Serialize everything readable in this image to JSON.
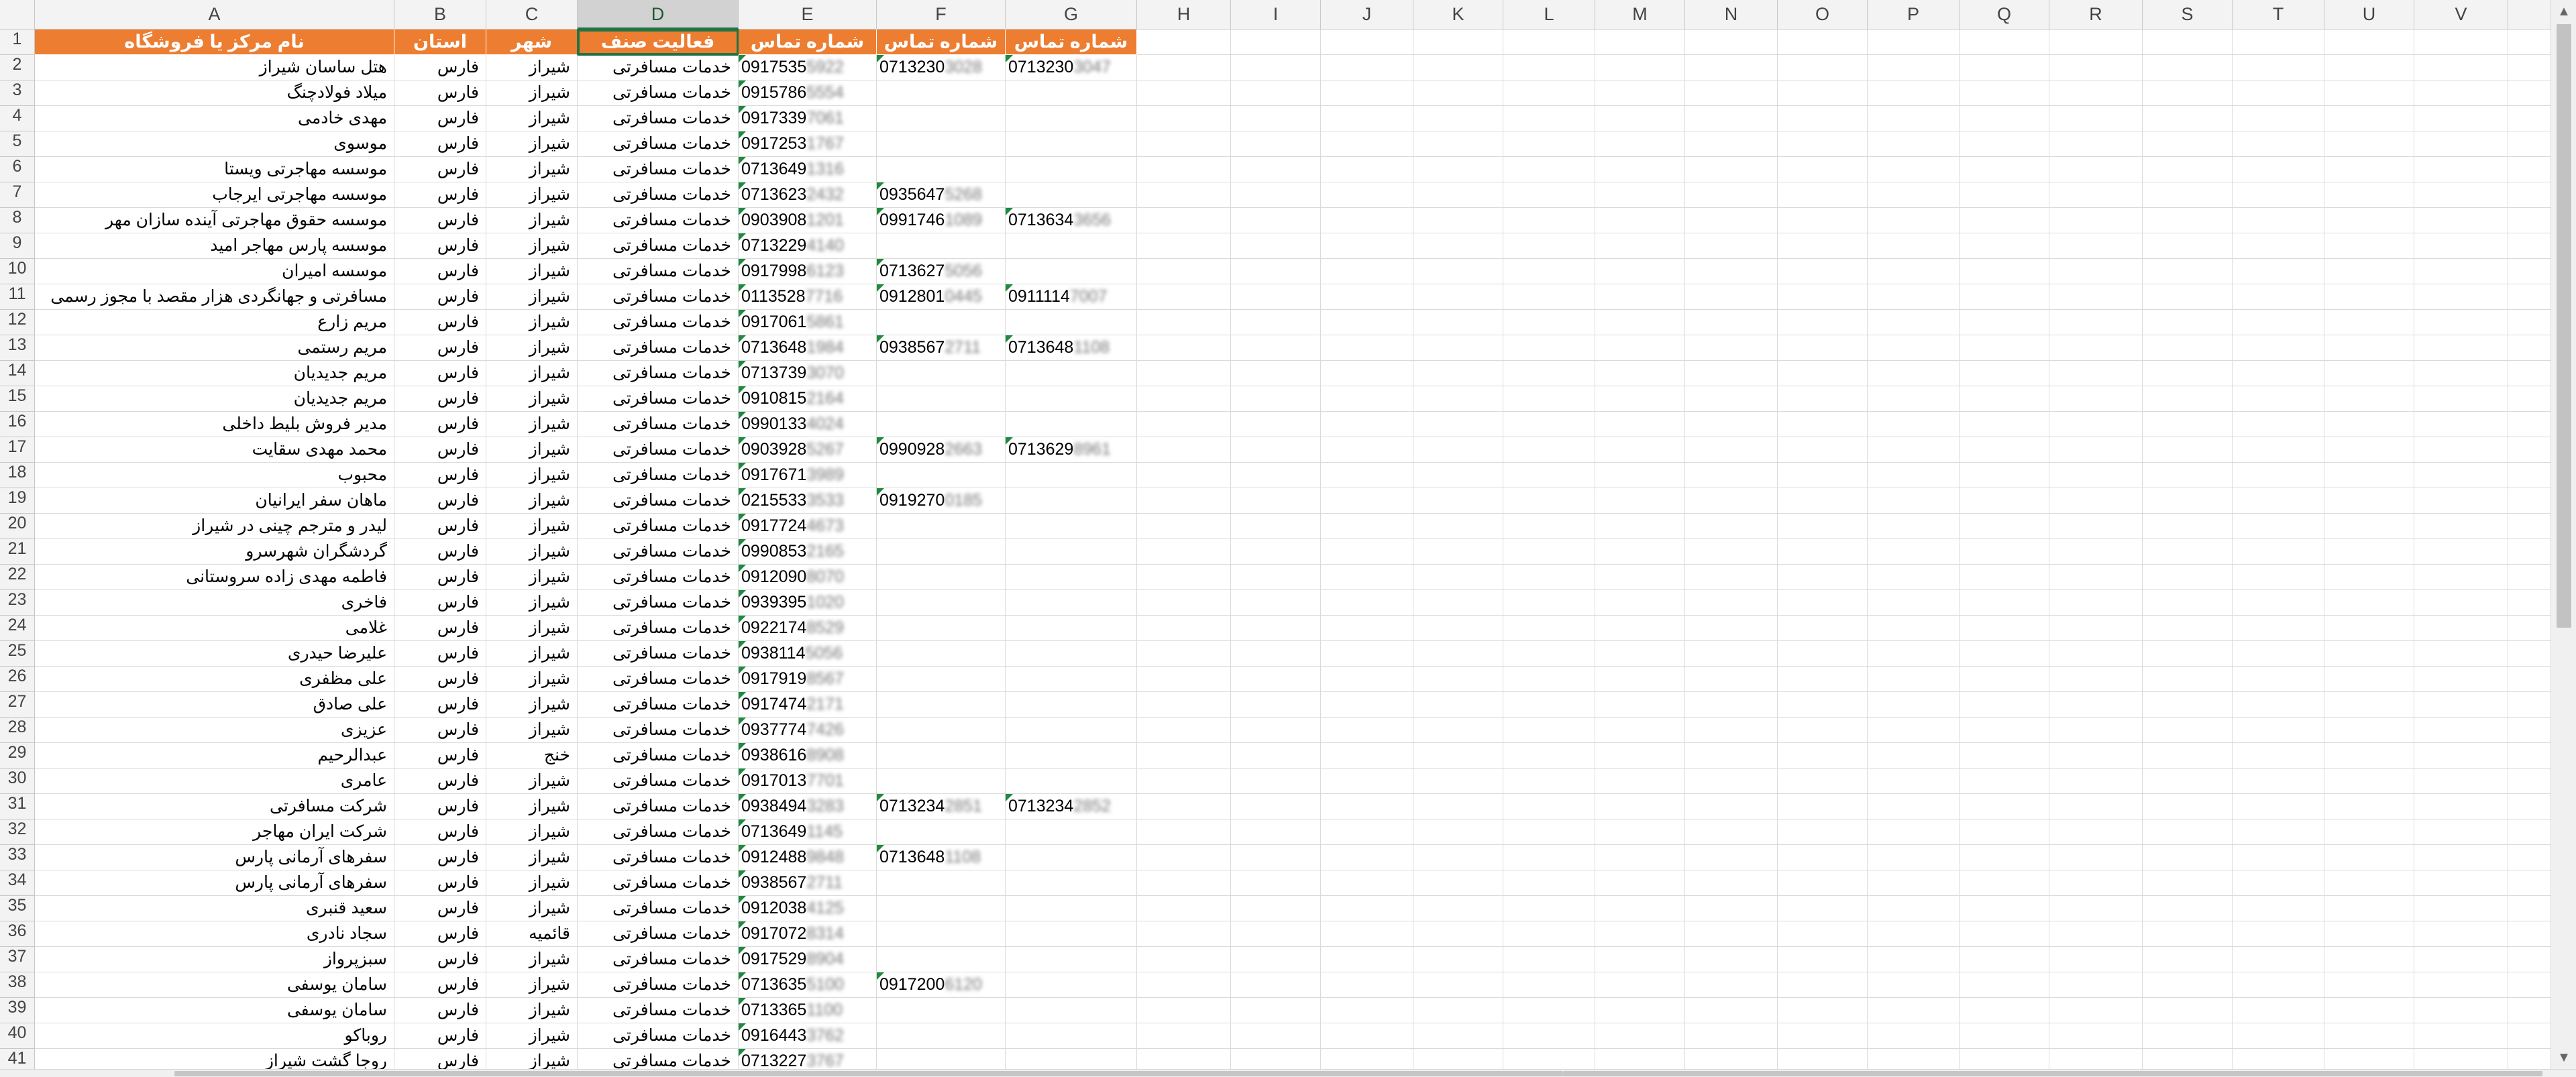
{
  "columns": [
    "A",
    "B",
    "C",
    "D",
    "E",
    "F",
    "G",
    "H",
    "I",
    "J",
    "K",
    "L",
    "M",
    "N",
    "O",
    "P",
    "Q",
    "R",
    "S",
    "T",
    "U",
    "V"
  ],
  "selected_column": "D",
  "header": {
    "row_number": "1",
    "name": "نام مرکز یا فروشگاه",
    "province": "استان",
    "city": "شهر",
    "activity": "فعالیت صنف",
    "phone1": "شماره تماس",
    "phone2": "شماره تماس",
    "phone3": "شماره تماس"
  },
  "rows": [
    {
      "row": "2",
      "name": "هتل ساسان شیراز",
      "province": "فارس",
      "city": "شیراز",
      "activity": "خدمات مسافرتی",
      "p1": "0917535",
      "p1b": "5922",
      "p2": "0713230",
      "p2b": "3028",
      "p3": "0713230",
      "p3b": "3047"
    },
    {
      "row": "3",
      "name": "میلاد فولادچنگ",
      "province": "فارس",
      "city": "شیراز",
      "activity": "خدمات مسافرتی",
      "p1": "0915786",
      "p1b": "5554",
      "p2": "",
      "p2b": "",
      "p3": "",
      "p3b": ""
    },
    {
      "row": "4",
      "name": "مهدی خادمی",
      "province": "فارس",
      "city": "شیراز",
      "activity": "خدمات مسافرتی",
      "p1": "0917339",
      "p1b": "7061",
      "p2": "",
      "p2b": "",
      "p3": "",
      "p3b": ""
    },
    {
      "row": "5",
      "name": "موسوی",
      "province": "فارس",
      "city": "شیراز",
      "activity": "خدمات مسافرتی",
      "p1": "0917253",
      "p1b": "1767",
      "p2": "",
      "p2b": "",
      "p3": "",
      "p3b": ""
    },
    {
      "row": "6",
      "name": "موسسه مهاجرتی ویستا",
      "province": "فارس",
      "city": "شیراز",
      "activity": "خدمات مسافرتی",
      "p1": "0713649",
      "p1b": "1316",
      "p2": "",
      "p2b": "",
      "p3": "",
      "p3b": ""
    },
    {
      "row": "7",
      "name": "موسسه مهاجرتی ایرجاب",
      "province": "فارس",
      "city": "شیراز",
      "activity": "خدمات مسافرتی",
      "p1": "0713623",
      "p1b": "2432",
      "p2": "0935647",
      "p2b": "5268",
      "p3": "",
      "p3b": ""
    },
    {
      "row": "8",
      "name": "موسسه حقوق مهاجرتی آینده سازان مهر",
      "province": "فارس",
      "city": "شیراز",
      "activity": "خدمات مسافرتی",
      "p1": "0903908",
      "p1b": "1201",
      "p2": "0991746",
      "p2b": "1089",
      "p3": "0713634",
      "p3b": "3656"
    },
    {
      "row": "9",
      "name": "موسسه پارس مهاجر امید",
      "province": "فارس",
      "city": "شیراز",
      "activity": "خدمات مسافرتی",
      "p1": "0713229",
      "p1b": "4140",
      "p2": "",
      "p2b": "",
      "p3": "",
      "p3b": ""
    },
    {
      "row": "10",
      "name": "موسسه امیران",
      "province": "فارس",
      "city": "شیراز",
      "activity": "خدمات مسافرتی",
      "p1": "0917998",
      "p1b": "6123",
      "p2": "0713627",
      "p2b": "5056",
      "p3": "",
      "p3b": ""
    },
    {
      "row": "11",
      "name": "مسافرتی و جهانگردی هزار مقصد با مجوز رسمی",
      "province": "فارس",
      "city": "شیراز",
      "activity": "خدمات مسافرتی",
      "p1": "0113528",
      "p1b": "7716",
      "p2": "0912801",
      "p2b": "0445",
      "p3": "0911114",
      "p3b": "7007"
    },
    {
      "row": "12",
      "name": "مریم زارع",
      "province": "فارس",
      "city": "شیراز",
      "activity": "خدمات مسافرتی",
      "p1": "0917061",
      "p1b": "5861",
      "p2": "",
      "p2b": "",
      "p3": "",
      "p3b": ""
    },
    {
      "row": "13",
      "name": "مریم رستمی",
      "province": "فارس",
      "city": "شیراز",
      "activity": "خدمات مسافرتی",
      "p1": "0713648",
      "p1b": "1984",
      "p2": "0938567",
      "p2b": "2711",
      "p3": "0713648",
      "p3b": "1108"
    },
    {
      "row": "14",
      "name": "مریم جدیدیان",
      "province": "فارس",
      "city": "شیراز",
      "activity": "خدمات مسافرتی",
      "p1": "0713739",
      "p1b": "3070",
      "p2": "",
      "p2b": "",
      "p3": "",
      "p3b": ""
    },
    {
      "row": "15",
      "name": "مریم جدیدیان",
      "province": "فارس",
      "city": "شیراز",
      "activity": "خدمات مسافرتی",
      "p1": "0910815",
      "p1b": "2164",
      "p2": "",
      "p2b": "",
      "p3": "",
      "p3b": ""
    },
    {
      "row": "16",
      "name": "مدیر فروش بلیط داخلی",
      "province": "فارس",
      "city": "شیراز",
      "activity": "خدمات مسافرتی",
      "p1": "0990133",
      "p1b": "4024",
      "p2": "",
      "p2b": "",
      "p3": "",
      "p3b": ""
    },
    {
      "row": "17",
      "name": "محمد مهدی سقایت",
      "province": "فارس",
      "city": "شیراز",
      "activity": "خدمات مسافرتی",
      "p1": "0903928",
      "p1b": "5267",
      "p2": "0990928",
      "p2b": "2663",
      "p3": "0713629",
      "p3b": "8961"
    },
    {
      "row": "18",
      "name": "محبوب",
      "province": "فارس",
      "city": "شیراز",
      "activity": "خدمات مسافرتی",
      "p1": "0917671",
      "p1b": "3989",
      "p2": "",
      "p2b": "",
      "p3": "",
      "p3b": ""
    },
    {
      "row": "19",
      "name": "ماهان سفر ایرانیان",
      "province": "فارس",
      "city": "شیراز",
      "activity": "خدمات مسافرتی",
      "p1": "0215533",
      "p1b": "3533",
      "p2": "0919270",
      "p2b": "0185",
      "p3": "",
      "p3b": ""
    },
    {
      "row": "20",
      "name": "لیدر و مترجم چینی در شیراز",
      "province": "فارس",
      "city": "شیراز",
      "activity": "خدمات مسافرتی",
      "p1": "0917724",
      "p1b": "4673",
      "p2": "",
      "p2b": "",
      "p3": "",
      "p3b": ""
    },
    {
      "row": "21",
      "name": "گردشگران شهرسرو",
      "province": "فارس",
      "city": "شیراز",
      "activity": "خدمات مسافرتی",
      "p1": "0990853",
      "p1b": "2165",
      "p2": "",
      "p2b": "",
      "p3": "",
      "p3b": ""
    },
    {
      "row": "22",
      "name": "فاطمه مهدی زاده سروستانی",
      "province": "فارس",
      "city": "شیراز",
      "activity": "خدمات مسافرتی",
      "p1": "0912090",
      "p1b": "8070",
      "p2": "",
      "p2b": "",
      "p3": "",
      "p3b": ""
    },
    {
      "row": "23",
      "name": "فاخری",
      "province": "فارس",
      "city": "شیراز",
      "activity": "خدمات مسافرتی",
      "p1": "0939395",
      "p1b": "1020",
      "p2": "",
      "p2b": "",
      "p3": "",
      "p3b": ""
    },
    {
      "row": "24",
      "name": "غلامی",
      "province": "فارس",
      "city": "شیراز",
      "activity": "خدمات مسافرتی",
      "p1": "0922174",
      "p1b": "8529",
      "p2": "",
      "p2b": "",
      "p3": "",
      "p3b": ""
    },
    {
      "row": "25",
      "name": "علیرضا حیدری",
      "province": "فارس",
      "city": "شیراز",
      "activity": "خدمات مسافرتی",
      "p1": "0938114",
      "p1b": "5056",
      "p2": "",
      "p2b": "",
      "p3": "",
      "p3b": ""
    },
    {
      "row": "26",
      "name": "علی مظفری",
      "province": "فارس",
      "city": "شیراز",
      "activity": "خدمات مسافرتی",
      "p1": "0917919",
      "p1b": "8567",
      "p2": "",
      "p2b": "",
      "p3": "",
      "p3b": ""
    },
    {
      "row": "27",
      "name": "علی صادق",
      "province": "فارس",
      "city": "شیراز",
      "activity": "خدمات مسافرتی",
      "p1": "0917474",
      "p1b": "2171",
      "p2": "",
      "p2b": "",
      "p3": "",
      "p3b": ""
    },
    {
      "row": "28",
      "name": "عزیزی",
      "province": "فارس",
      "city": "شیراز",
      "activity": "خدمات مسافرتی",
      "p1": "0937774",
      "p1b": "7426",
      "p2": "",
      "p2b": "",
      "p3": "",
      "p3b": ""
    },
    {
      "row": "29",
      "name": "عبدالرحیم",
      "province": "فارس",
      "city": "خنج",
      "activity": "خدمات مسافرتی",
      "p1": "0938616",
      "p1b": "8908",
      "p2": "",
      "p2b": "",
      "p3": "",
      "p3b": ""
    },
    {
      "row": "30",
      "name": "عامری",
      "province": "فارس",
      "city": "شیراز",
      "activity": "خدمات مسافرتی",
      "p1": "0917013",
      "p1b": "7701",
      "p2": "",
      "p2b": "",
      "p3": "",
      "p3b": ""
    },
    {
      "row": "31",
      "name": "شرکت مسافرتی",
      "province": "فارس",
      "city": "شیراز",
      "activity": "خدمات مسافرتی",
      "p1": "0938494",
      "p1b": "3283",
      "p2": "0713234",
      "p2b": "2851",
      "p3": "0713234",
      "p3b": "2852"
    },
    {
      "row": "32",
      "name": "شرکت ایران مهاجر",
      "province": "فارس",
      "city": "شیراز",
      "activity": "خدمات مسافرتی",
      "p1": "0713649",
      "p1b": "1145",
      "p2": "",
      "p2b": "",
      "p3": "",
      "p3b": ""
    },
    {
      "row": "33",
      "name": "سفرهای آرمانی پارس",
      "province": "فارس",
      "city": "شیراز",
      "activity": "خدمات مسافرتی",
      "p1": "0912488",
      "p1b": "9848",
      "p2": "0713648",
      "p2b": "1108",
      "p3": "",
      "p3b": ""
    },
    {
      "row": "34",
      "name": "سفرهای آرمانی پارس",
      "province": "فارس",
      "city": "شیراز",
      "activity": "خدمات مسافرتی",
      "p1": "0938567",
      "p1b": "2711",
      "p2": "",
      "p2b": "",
      "p3": "",
      "p3b": ""
    },
    {
      "row": "35",
      "name": "سعید قنبری",
      "province": "فارس",
      "city": "شیراز",
      "activity": "خدمات مسافرتی",
      "p1": "0912038",
      "p1b": "4125",
      "p2": "",
      "p2b": "",
      "p3": "",
      "p3b": ""
    },
    {
      "row": "36",
      "name": "سجاد نادری",
      "province": "فارس",
      "city": "قائمیه",
      "activity": "خدمات مسافرتی",
      "p1": "0917072",
      "p1b": "8314",
      "p2": "",
      "p2b": "",
      "p3": "",
      "p3b": ""
    },
    {
      "row": "37",
      "name": "سبزپرواز",
      "province": "فارس",
      "city": "شیراز",
      "activity": "خدمات مسافرتی",
      "p1": "0917529",
      "p1b": "8904",
      "p2": "",
      "p2b": "",
      "p3": "",
      "p3b": ""
    },
    {
      "row": "38",
      "name": "سامان یوسفی",
      "province": "فارس",
      "city": "شیراز",
      "activity": "خدمات مسافرتی",
      "p1": "0713635",
      "p1b": "5100",
      "p2": "0917200",
      "p2b": "6120",
      "p3": "",
      "p3b": ""
    },
    {
      "row": "39",
      "name": "سامان یوسفی",
      "province": "فارس",
      "city": "شیراز",
      "activity": "خدمات مسافرتی",
      "p1": "0713365",
      "p1b": "1100",
      "p2": "",
      "p2b": "",
      "p3": "",
      "p3b": ""
    },
    {
      "row": "40",
      "name": "روباکو",
      "province": "فارس",
      "city": "شیراز",
      "activity": "خدمات مسافرتی",
      "p1": "0916443",
      "p1b": "3762",
      "p2": "",
      "p2b": "",
      "p3": "",
      "p3b": ""
    },
    {
      "row": "41",
      "name": "روجا گشت شیراز",
      "province": "فارس",
      "city": "شیراز",
      "activity": "خدمات مسافرتی",
      "p1": "0713227",
      "p1b": "3767",
      "p2": "",
      "p2b": "",
      "p3": "",
      "p3b": ""
    }
  ],
  "colors": {
    "header_fill": "#ed7d31",
    "header_text": "#ffffff",
    "selection": "#217346",
    "error_triangle": "#1e8a3e"
  }
}
